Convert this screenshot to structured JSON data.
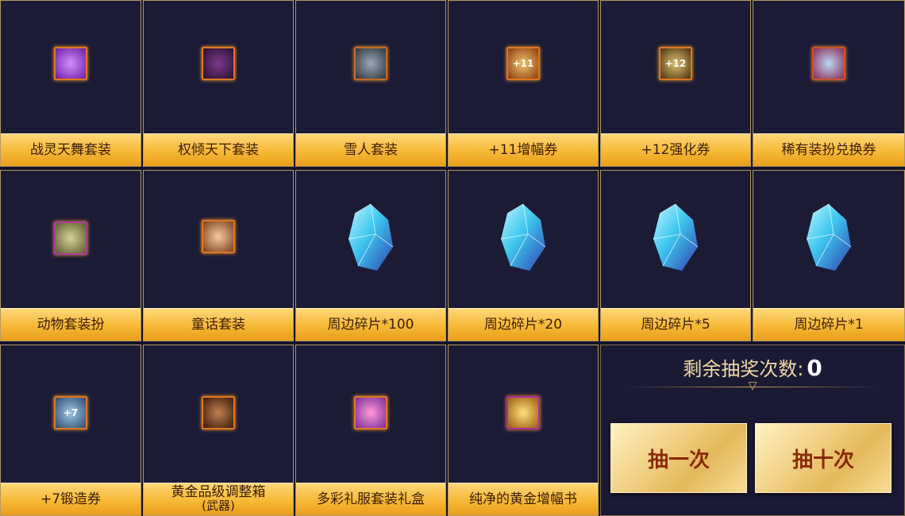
{
  "grid": {
    "row1": [
      {
        "label": "战灵天舞套装",
        "icon": "purple-gift-box-icon"
      },
      {
        "label": "权倾天下套装",
        "icon": "dark-treasure-chest-icon"
      },
      {
        "label": "雪人套装",
        "icon": "snowman-costume-box-icon"
      },
      {
        "label": "+11增幅券",
        "icon": "plus11-amplify-ticket-icon",
        "icon_text": "+11"
      },
      {
        "label": "+12强化券",
        "icon": "plus12-enhance-ticket-icon",
        "icon_text": "+12"
      },
      {
        "label": "稀有装扮兑换券",
        "icon": "rare-costume-coupon-icon"
      }
    ],
    "row2": [
      {
        "label": "动物套装扮",
        "icon": "animal-costume-box-icon"
      },
      {
        "label": "童话套装",
        "icon": "fairytale-costume-box-icon"
      },
      {
        "label": "周边碎片*100",
        "icon": "blue-crystal-shard-icon"
      },
      {
        "label": "周边碎片*20",
        "icon": "blue-crystal-shard-icon"
      },
      {
        "label": "周边碎片*5",
        "icon": "blue-crystal-shard-icon"
      },
      {
        "label": "周边碎片*1",
        "icon": "blue-crystal-shard-icon"
      }
    ],
    "row3": [
      {
        "label": "+7锻造券",
        "icon": "plus7-forge-ticket-icon",
        "icon_text": "+7"
      },
      {
        "label_line1": "黄金品级调整箱",
        "label_line2": "(武器)",
        "icon": "gold-grade-box-icon"
      },
      {
        "label": "多彩礼服套装礼盒",
        "icon": "colorful-gift-box-icon"
      },
      {
        "label": "纯净的黄金增幅书",
        "icon": "golden-amplify-book-icon"
      }
    ]
  },
  "panel": {
    "remaining_label": "剩余抽奖次数:",
    "remaining_count": "0",
    "draw_once_label": "抽一次",
    "draw_ten_label": "抽十次"
  },
  "colors": {
    "background": "#1c1b36",
    "label_gold": "#f6b935",
    "border": "#b59a5e",
    "button_text": "#8a2a06"
  }
}
